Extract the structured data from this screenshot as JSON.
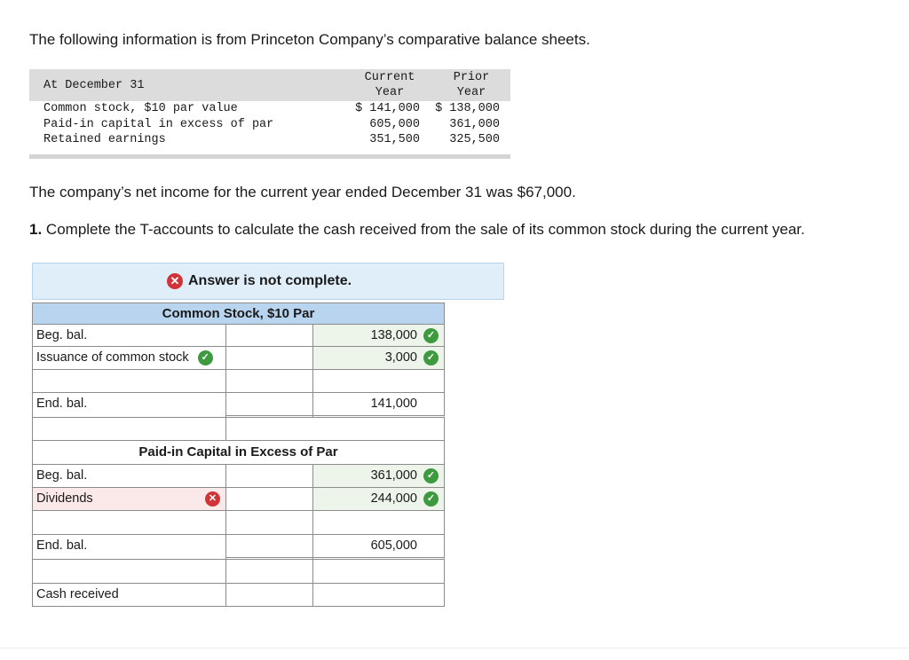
{
  "intro": "The following information is from Princeton Company’s comparative balance sheets.",
  "balance_sheet": {
    "header_label": "At December 31",
    "col_current_1": "Current",
    "col_current_2": "Year",
    "col_prior_1": "Prior",
    "col_prior_2": "Year",
    "rows": [
      {
        "label": "Common stock, $10 par value",
        "current": "$ 141,000",
        "prior": "$ 138,000"
      },
      {
        "label": "Paid-in capital in excess of par",
        "current": "605,000",
        "prior": "361,000"
      },
      {
        "label": "Retained earnings",
        "current": "351,500",
        "prior": "325,500"
      }
    ]
  },
  "net_income_text": "The company’s net income for the current year ended December 31 was $67,000.",
  "question": {
    "number": "1.",
    "text": "Complete the T-accounts to calculate the cash received from the sale of its common stock during the current year."
  },
  "banner": {
    "message": "Answer is not complete."
  },
  "common_stock": {
    "title": "Common Stock, $10 Par",
    "beg_label": "Beg. bal.",
    "beg_value": "138,000",
    "issuance_label": "Issuance of common stock",
    "issuance_value": "3,000",
    "end_label": "End. bal.",
    "end_value": "141,000"
  },
  "paid_in": {
    "title": "Paid-in Capital in Excess of Par",
    "beg_label": "Beg. bal.",
    "beg_value": "361,000",
    "dividends_label": "Dividends",
    "dividends_value": "244,000",
    "end_label": "End. bal.",
    "end_value": "605,000"
  },
  "cash_received_label": "Cash received",
  "colors": {
    "check": "#3d9a3f",
    "error": "#d13438",
    "header_blue": "#b9d4ee",
    "banner_bg": "#dfeef9"
  }
}
